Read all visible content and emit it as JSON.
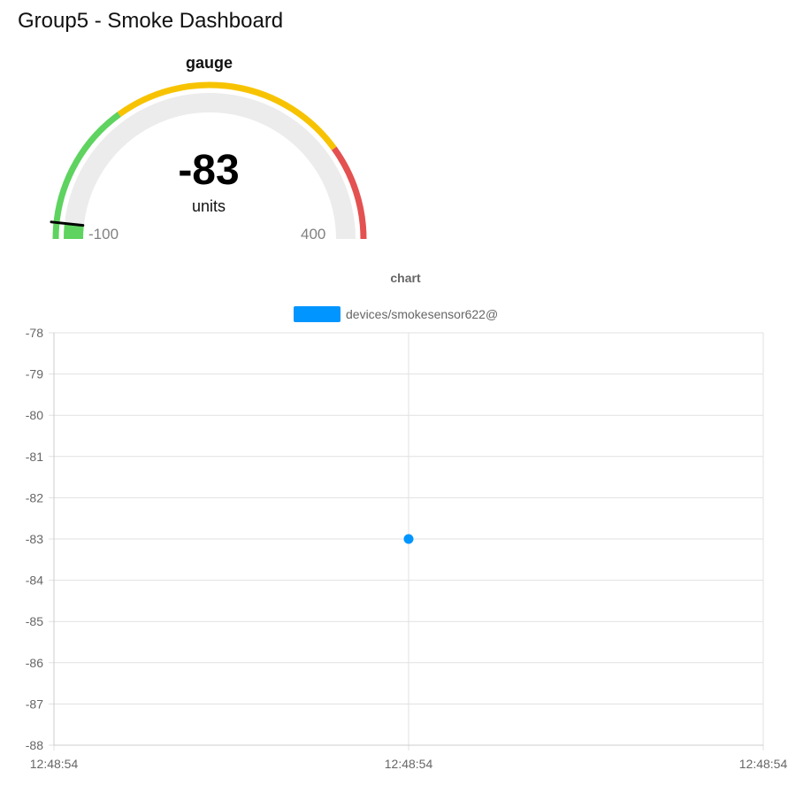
{
  "page": {
    "title": "Group5 - Smoke Dashboard"
  },
  "gauge": {
    "label": "gauge",
    "value": -83,
    "value_text": "-83",
    "units": "units",
    "min": -100,
    "max": 400,
    "min_text": "-100",
    "max_text": "400",
    "segments": [
      {
        "from": -100,
        "to": 50,
        "color": "#5ed35f"
      },
      {
        "from": 50,
        "to": 300,
        "color": "#f7c300"
      },
      {
        "from": 300,
        "to": 400,
        "color": "#e45151"
      }
    ],
    "track_color": "#ececec",
    "fill_color": "#5ed35f",
    "needle_color": "#000000"
  },
  "chart": {
    "title": "chart",
    "legend": "devices/smokesensor622@",
    "color": "#0095ff"
  },
  "chart_data": {
    "type": "scatter",
    "title": "chart",
    "xlabel": "",
    "ylabel": "",
    "x_ticks": [
      "12:48:54",
      "12:48:54",
      "12:48:54"
    ],
    "y_ticks": [
      -78,
      -79,
      -80,
      -81,
      -82,
      -83,
      -84,
      -85,
      -86,
      -87,
      -88
    ],
    "ylim": [
      -88,
      -78
    ],
    "grid": true,
    "legend_position": "top",
    "series": [
      {
        "name": "devices/smokesensor622@",
        "x": [
          "12:48:54"
        ],
        "values": [
          -83
        ],
        "color": "#0095ff"
      }
    ]
  }
}
